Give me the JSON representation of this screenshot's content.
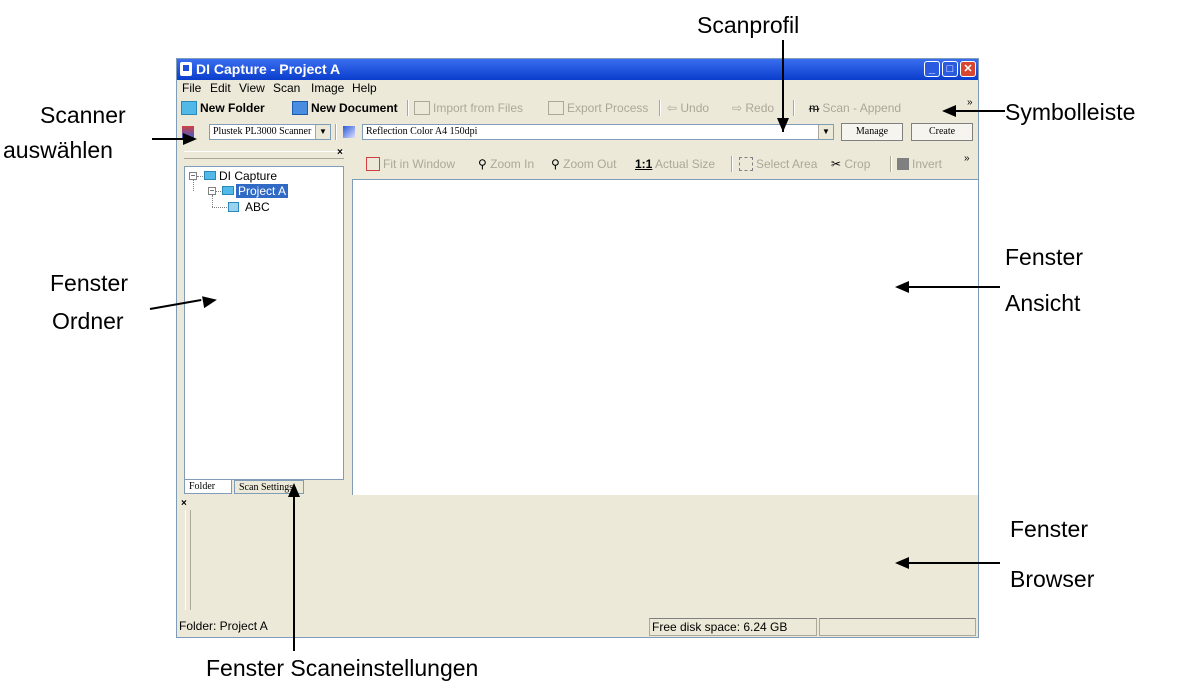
{
  "window": {
    "title": "DI Capture - Project A",
    "controls": {
      "minimize": "_",
      "maximize": "□",
      "close": "✕"
    }
  },
  "menu": [
    {
      "label": "File"
    },
    {
      "label": "Edit"
    },
    {
      "label": "View"
    },
    {
      "label": "Scan"
    },
    {
      "label": "Image"
    },
    {
      "label": "Help"
    }
  ],
  "toolbar1": {
    "new_folder": "New Folder",
    "new_document": "New Document",
    "import_from_files": "Import from Files",
    "export_process": "Export Process",
    "undo": "Undo",
    "redo": "Redo",
    "scan_append": "Scan - Append",
    "more": "»"
  },
  "toolbar2": {
    "scanner_select": "Plustek PL3000 Scanner",
    "scan_profile": "Reflection Color A4 150dpi",
    "manage": "Manage",
    "create": "Create"
  },
  "toolbar3": {
    "fit_in_window": "Fit in Window",
    "zoom_in": "Zoom In",
    "zoom_out": "Zoom Out",
    "actual_size_prefix": "1:1",
    "actual_size": "Actual Size",
    "select_area": "Select Area",
    "crop": "Crop",
    "invert": "Invert",
    "more": "»"
  },
  "folder_tree": {
    "root": "DI Capture",
    "project": "Project A",
    "document": "ABC"
  },
  "left_tabs": {
    "folder": "Folder",
    "scan_settings": "Scan Settings"
  },
  "panel_close": "×",
  "browser_close": "×",
  "status": {
    "folder": "Folder: Project A",
    "disk": "Free disk space: 6.24 GB"
  },
  "callouts": {
    "scanprofil": "Scanprofil",
    "symbolleiste": "Symbolleiste",
    "scanner_line1": "Scanner",
    "scanner_line2": "auswählen",
    "fenster_ordner_line1": "Fenster",
    "fenster_ordner_line2": "Ordner",
    "fenster_ansicht_line1": "Fenster",
    "fenster_ansicht_line2": "Ansicht",
    "fenster_browser_line1": "Fenster",
    "fenster_browser_line2": "Browser",
    "fenster_scaneinstellungen": "Fenster Scaneinstellungen"
  },
  "colors": {
    "titlebar": "#0a3dcc",
    "selection": "#316ac5",
    "window_bg": "#ece9d8"
  }
}
